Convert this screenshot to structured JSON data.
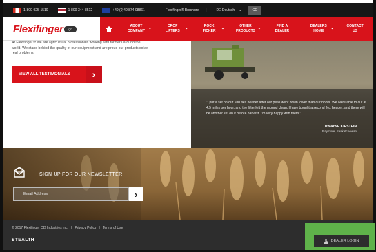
{
  "topbar": {
    "phone_ca": "1-800-925-1510",
    "phone_us": "1-800-344-8512",
    "phone_eu": "+49 (0)40 874 08861",
    "brochure": "Flexifinger® Brochure",
    "separator": "|",
    "language": "DE Deutsch",
    "go": "GO"
  },
  "brand": {
    "logo_text": "Flexifinger",
    "logo_badge": "QD",
    "accent": "#d8131b"
  },
  "nav": {
    "items": [
      {
        "label": "ABOUT\nCOMPANY"
      },
      {
        "label": "CROP\nLIFTERS"
      },
      {
        "label": "ROCK\nPICKER"
      },
      {
        "label": "OTHER\nPRODUCTS"
      },
      {
        "label": "FIND A\nDEALER"
      },
      {
        "label": "DEALERS\nHOME"
      },
      {
        "label": "CONTACT\nUS"
      }
    ]
  },
  "testimonials": {
    "intro": "At Flexifinger™ we are agricultural professionals working with farmers around the world. We stand behind the quality of our equipment and are proud our products solve real problems.",
    "button_label": "VIEW ALL TESTIMONIALS",
    "quote": "\"I put a set on our 930 flex header after our peas went down lower than our boots. We were able to cut at 4.5 miles per hour, and the lifter left the ground clean. I have bought a second flex header, and there will be another set on it before harvest. I'm very happy with them.\"",
    "author": "DWAYNE KIRSTEIN",
    "location": "Raymore, Saskatchewan"
  },
  "newsletter": {
    "heading": "SIGN UP FOR OUR NEWSLETTER",
    "email_placeholder": "Email Address"
  },
  "footer": {
    "copyright": "© 2017 Flexifinger QD Industries Inc.",
    "sep": "|",
    "privacy": "Privacy Policy",
    "terms": "Terms of Use",
    "credit": "STEALTH",
    "dealer_login": "DEALER LOGIN",
    "highlight": "#5fb24a"
  }
}
